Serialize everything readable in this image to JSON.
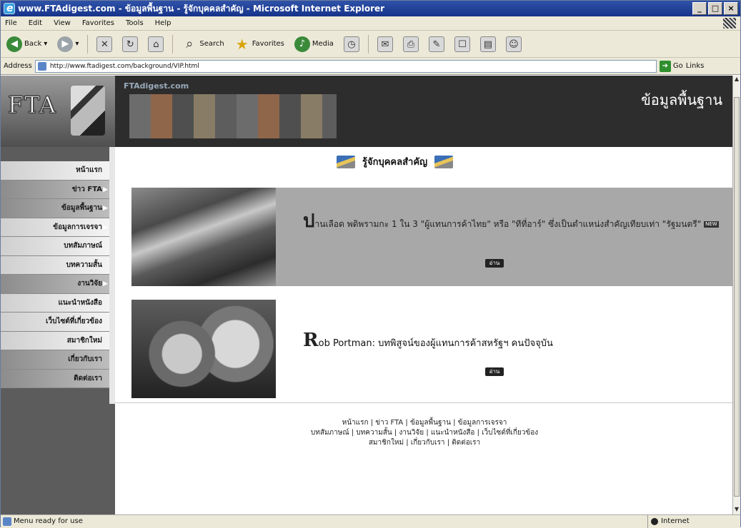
{
  "window": {
    "title": "www.FTAdigest.com - ข้อมูลพื้นฐาน - รู้จักบุคคลสำคัญ - Microsoft Internet Explorer"
  },
  "menu": [
    "File",
    "Edit",
    "View",
    "Favorites",
    "Tools",
    "Help"
  ],
  "toolbar": {
    "back": "Back",
    "search": "Search",
    "favorites": "Favorites",
    "media": "Media"
  },
  "address": {
    "label": "Address",
    "url": "http://www.ftadigest.com/background/VIP.html",
    "go": "Go",
    "links": "Links"
  },
  "site": {
    "banner_name": "FTAdigest.com",
    "banner_tagline": "ข้อมูลพื้นฐาน",
    "logo_text": "FTA",
    "nav": [
      "หน้าแรก",
      "ข่าว FTA",
      "ข้อมูลพื้นฐาน",
      "ข้อมูลการเจรจา",
      "บทสัมภาษณ์",
      "บทความสั้น",
      "งานวิจัย",
      "แนะนำหนังสือ",
      "เว็บไซต์ที่เกี่ยวข้อง",
      "สมาชิกใหม่",
      "เกี่ยวกับเรา",
      "ติดต่อเรา"
    ],
    "heading": "รู้จักบุคคลสำคัญ",
    "articles": [
      {
        "dropcap": "ป",
        "text": "านเลือด พดิพรามกะ 1 ใน 3 \"ผู้แทนการค้าไทย\" หรือ \"ทีที่อาร์\" ซึ่งเป็นตำแหน่งสำคัญเทียบเท่า \"รัฐมนตรี\"",
        "badge": "NEW",
        "more": "อ่าน"
      },
      {
        "dropcap": "R",
        "text": "ob Portman: บทพิสูจน์ของผู้แทนการค้าสหรัฐฯ คนปัจจุบัน",
        "more": "อ่าน"
      }
    ],
    "footer_lines": [
      "หน้าแรก | ข่าว FTA | ข้อมูลพื้นฐาน | ข้อมูลการเจรจา",
      "บทสัมภาษณ์ | บทความสั้น | งานวิจัย | แนะนำหนังสือ | เว็บไซต์ที่เกี่ยวข้อง",
      "สมาชิกใหม่ | เกี่ยวกับเรา | ติดต่อเรา"
    ]
  },
  "status": {
    "text": "Menu ready for use",
    "zone": "Internet"
  }
}
